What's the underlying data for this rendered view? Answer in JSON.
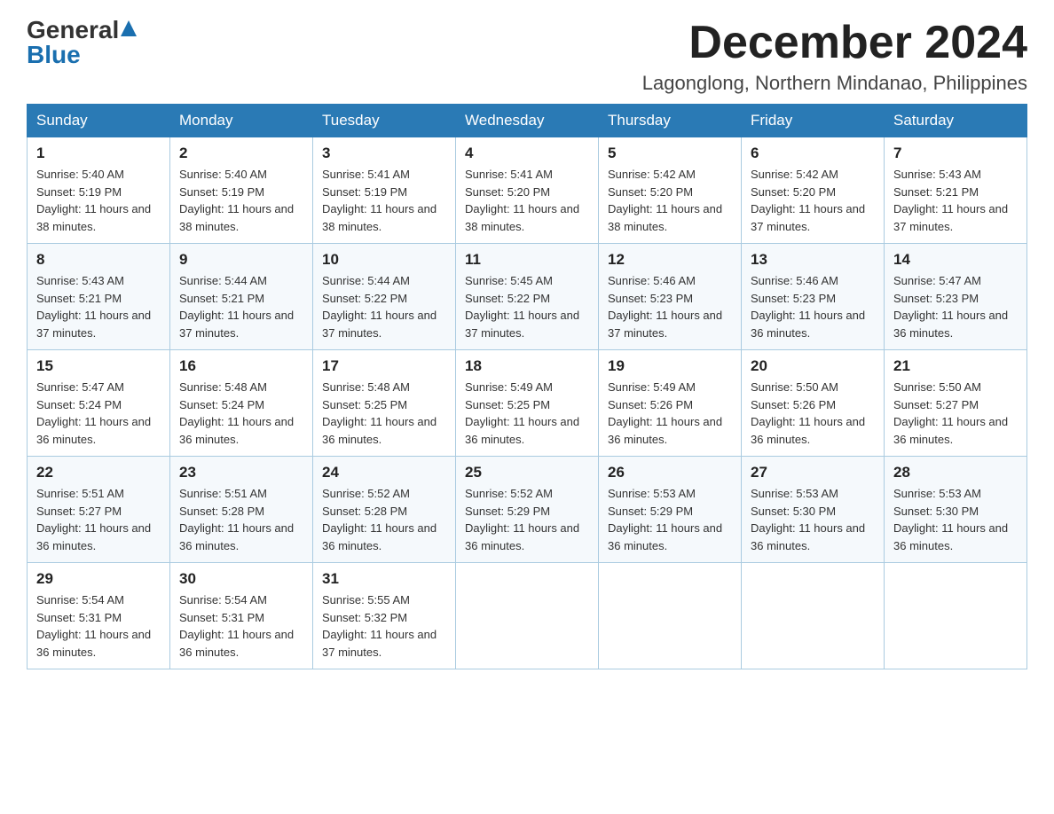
{
  "logo": {
    "general": "General",
    "blue": "Blue"
  },
  "title": {
    "month_year": "December 2024",
    "location": "Lagonglong, Northern Mindanao, Philippines"
  },
  "days_of_week": [
    "Sunday",
    "Monday",
    "Tuesday",
    "Wednesday",
    "Thursday",
    "Friday",
    "Saturday"
  ],
  "weeks": [
    [
      {
        "day": "1",
        "sunrise": "5:40 AM",
        "sunset": "5:19 PM",
        "daylight": "11 hours and 38 minutes."
      },
      {
        "day": "2",
        "sunrise": "5:40 AM",
        "sunset": "5:19 PM",
        "daylight": "11 hours and 38 minutes."
      },
      {
        "day": "3",
        "sunrise": "5:41 AM",
        "sunset": "5:19 PM",
        "daylight": "11 hours and 38 minutes."
      },
      {
        "day": "4",
        "sunrise": "5:41 AM",
        "sunset": "5:20 PM",
        "daylight": "11 hours and 38 minutes."
      },
      {
        "day": "5",
        "sunrise": "5:42 AM",
        "sunset": "5:20 PM",
        "daylight": "11 hours and 38 minutes."
      },
      {
        "day": "6",
        "sunrise": "5:42 AM",
        "sunset": "5:20 PM",
        "daylight": "11 hours and 37 minutes."
      },
      {
        "day": "7",
        "sunrise": "5:43 AM",
        "sunset": "5:21 PM",
        "daylight": "11 hours and 37 minutes."
      }
    ],
    [
      {
        "day": "8",
        "sunrise": "5:43 AM",
        "sunset": "5:21 PM",
        "daylight": "11 hours and 37 minutes."
      },
      {
        "day": "9",
        "sunrise": "5:44 AM",
        "sunset": "5:21 PM",
        "daylight": "11 hours and 37 minutes."
      },
      {
        "day": "10",
        "sunrise": "5:44 AM",
        "sunset": "5:22 PM",
        "daylight": "11 hours and 37 minutes."
      },
      {
        "day": "11",
        "sunrise": "5:45 AM",
        "sunset": "5:22 PM",
        "daylight": "11 hours and 37 minutes."
      },
      {
        "day": "12",
        "sunrise": "5:46 AM",
        "sunset": "5:23 PM",
        "daylight": "11 hours and 37 minutes."
      },
      {
        "day": "13",
        "sunrise": "5:46 AM",
        "sunset": "5:23 PM",
        "daylight": "11 hours and 36 minutes."
      },
      {
        "day": "14",
        "sunrise": "5:47 AM",
        "sunset": "5:23 PM",
        "daylight": "11 hours and 36 minutes."
      }
    ],
    [
      {
        "day": "15",
        "sunrise": "5:47 AM",
        "sunset": "5:24 PM",
        "daylight": "11 hours and 36 minutes."
      },
      {
        "day": "16",
        "sunrise": "5:48 AM",
        "sunset": "5:24 PM",
        "daylight": "11 hours and 36 minutes."
      },
      {
        "day": "17",
        "sunrise": "5:48 AM",
        "sunset": "5:25 PM",
        "daylight": "11 hours and 36 minutes."
      },
      {
        "day": "18",
        "sunrise": "5:49 AM",
        "sunset": "5:25 PM",
        "daylight": "11 hours and 36 minutes."
      },
      {
        "day": "19",
        "sunrise": "5:49 AM",
        "sunset": "5:26 PM",
        "daylight": "11 hours and 36 minutes."
      },
      {
        "day": "20",
        "sunrise": "5:50 AM",
        "sunset": "5:26 PM",
        "daylight": "11 hours and 36 minutes."
      },
      {
        "day": "21",
        "sunrise": "5:50 AM",
        "sunset": "5:27 PM",
        "daylight": "11 hours and 36 minutes."
      }
    ],
    [
      {
        "day": "22",
        "sunrise": "5:51 AM",
        "sunset": "5:27 PM",
        "daylight": "11 hours and 36 minutes."
      },
      {
        "day": "23",
        "sunrise": "5:51 AM",
        "sunset": "5:28 PM",
        "daylight": "11 hours and 36 minutes."
      },
      {
        "day": "24",
        "sunrise": "5:52 AM",
        "sunset": "5:28 PM",
        "daylight": "11 hours and 36 minutes."
      },
      {
        "day": "25",
        "sunrise": "5:52 AM",
        "sunset": "5:29 PM",
        "daylight": "11 hours and 36 minutes."
      },
      {
        "day": "26",
        "sunrise": "5:53 AM",
        "sunset": "5:29 PM",
        "daylight": "11 hours and 36 minutes."
      },
      {
        "day": "27",
        "sunrise": "5:53 AM",
        "sunset": "5:30 PM",
        "daylight": "11 hours and 36 minutes."
      },
      {
        "day": "28",
        "sunrise": "5:53 AM",
        "sunset": "5:30 PM",
        "daylight": "11 hours and 36 minutes."
      }
    ],
    [
      {
        "day": "29",
        "sunrise": "5:54 AM",
        "sunset": "5:31 PM",
        "daylight": "11 hours and 36 minutes."
      },
      {
        "day": "30",
        "sunrise": "5:54 AM",
        "sunset": "5:31 PM",
        "daylight": "11 hours and 36 minutes."
      },
      {
        "day": "31",
        "sunrise": "5:55 AM",
        "sunset": "5:32 PM",
        "daylight": "11 hours and 37 minutes."
      },
      null,
      null,
      null,
      null
    ]
  ],
  "labels": {
    "sunrise_prefix": "Sunrise: ",
    "sunset_prefix": "Sunset: ",
    "daylight_prefix": "Daylight: "
  }
}
